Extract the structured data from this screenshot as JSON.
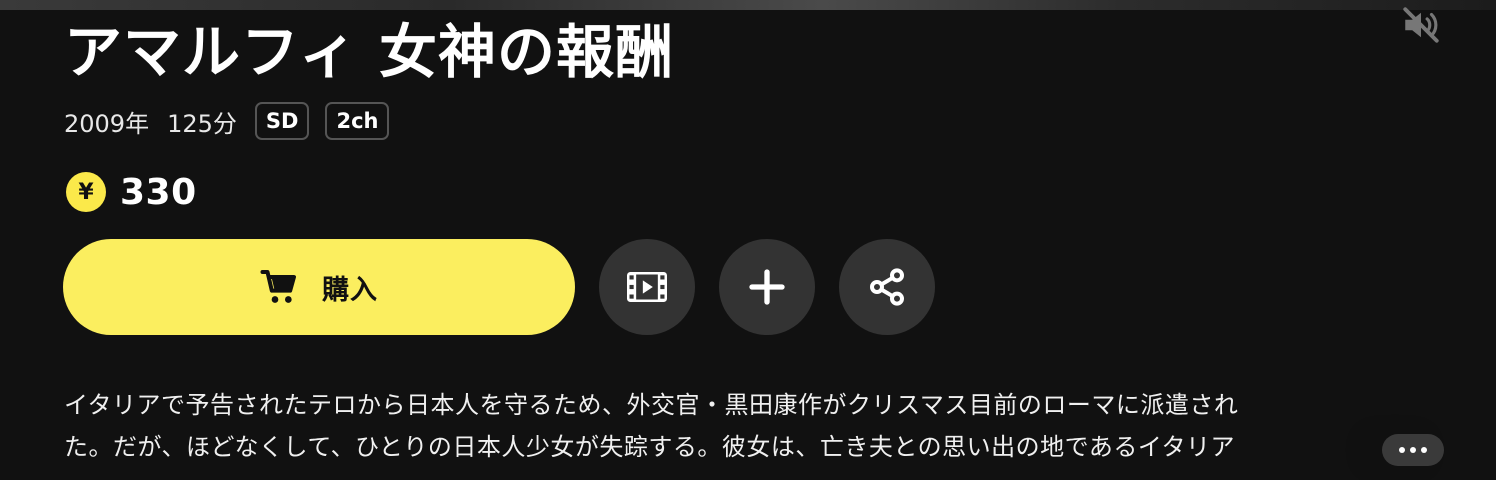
{
  "title": "アマルフィ 女神の報酬",
  "meta": {
    "year": "2009年",
    "duration": "125分",
    "badges": [
      "SD",
      "2ch"
    ]
  },
  "price": {
    "currency_symbol": "¥",
    "amount": "330"
  },
  "buy_button": {
    "label": "購入"
  },
  "actions": [
    {
      "name": "trailer-button",
      "icon": "film-play-icon"
    },
    {
      "name": "add-to-list-button",
      "icon": "plus-icon"
    },
    {
      "name": "share-button",
      "icon": "share-icon"
    }
  ],
  "description": {
    "line1": "イタリアで予告されたテロから日本人を守るため、外交官・黒田康作がクリスマス目前のローマに派遣され",
    "line2": "た。だが、ほどなくして、ひとりの日本人少女が失踪する。彼女は、亡き夫との思い出の地であるイタリア"
  },
  "colors": {
    "background": "#111111",
    "accent_yellow": "#fbee5f",
    "round_button": "#333333"
  }
}
